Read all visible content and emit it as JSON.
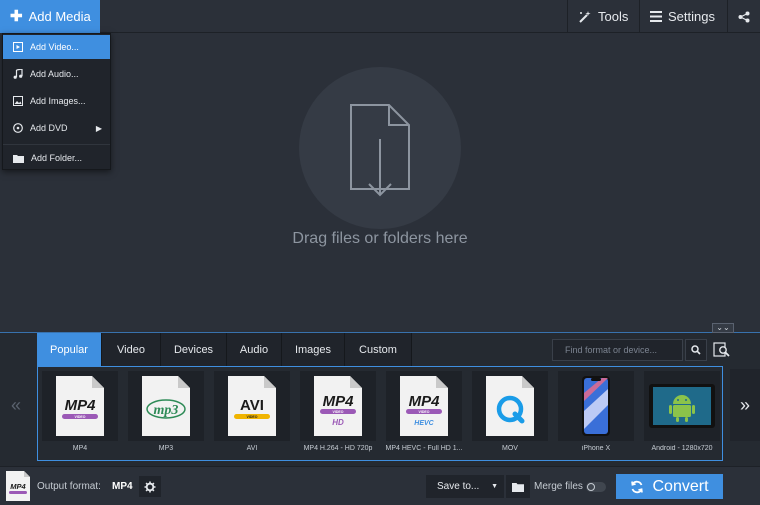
{
  "toolbar": {
    "add_media_label": "Add Media",
    "tools_label": "Tools",
    "settings_label": "Settings"
  },
  "add_menu": {
    "items": [
      {
        "label": "Add Video...",
        "icon": "video-icon",
        "active": true
      },
      {
        "label": "Add Audio...",
        "icon": "music-note-icon"
      },
      {
        "label": "Add Images...",
        "icon": "image-icon"
      },
      {
        "label": "Add DVD",
        "icon": "disc-icon",
        "submenu": true
      },
      {
        "label": "Add Folder...",
        "icon": "folder-icon"
      }
    ]
  },
  "dropzone": {
    "text": "Drag files or folders here"
  },
  "format_panel": {
    "tabs": [
      "Popular",
      "Video",
      "Devices",
      "Audio",
      "Images",
      "Custom"
    ],
    "active_tab": "Popular",
    "search_placeholder": "Find format or device...",
    "prev_label": "«",
    "next_label": "»",
    "collapse_label": "⌄⌄",
    "formats": [
      {
        "label": "MP4",
        "logo": "MP4",
        "sub": "VIDEO"
      },
      {
        "label": "MP3",
        "logo": "mp3"
      },
      {
        "label": "AVI",
        "logo": "AVI",
        "sub": "VIDEO"
      },
      {
        "label": "MP4 H.264 - HD 720p",
        "logo": "MP4",
        "sub": "VIDEO",
        "extra": "HD"
      },
      {
        "label": "MP4 HEVC - Full HD 1...",
        "logo": "MP4",
        "sub": "VIDEO",
        "extra": "HEVC"
      },
      {
        "label": "MOV",
        "logo": "Q"
      },
      {
        "label": "iPhone X",
        "logo": "iphone"
      },
      {
        "label": "Android - 1280x720",
        "logo": "android"
      }
    ]
  },
  "bottom": {
    "output_format_label": "Output format:",
    "output_format_value": "MP4",
    "output_icon_text": "MP4",
    "save_to_label": "Save to...",
    "merge_label": "Merge files",
    "merge_enabled": false,
    "convert_label": "Convert"
  },
  "colors": {
    "accent": "#3f8fe0",
    "background": "#2b3039",
    "panel": "#252a31",
    "mp4_purple": "#9b59b6",
    "avi_yellow": "#f0b400",
    "hevc_blue": "#3f8fe0",
    "mp3_green": "#2e8b57",
    "mov_blue": "#1a9ce8",
    "android_green": "#8bc34a"
  }
}
